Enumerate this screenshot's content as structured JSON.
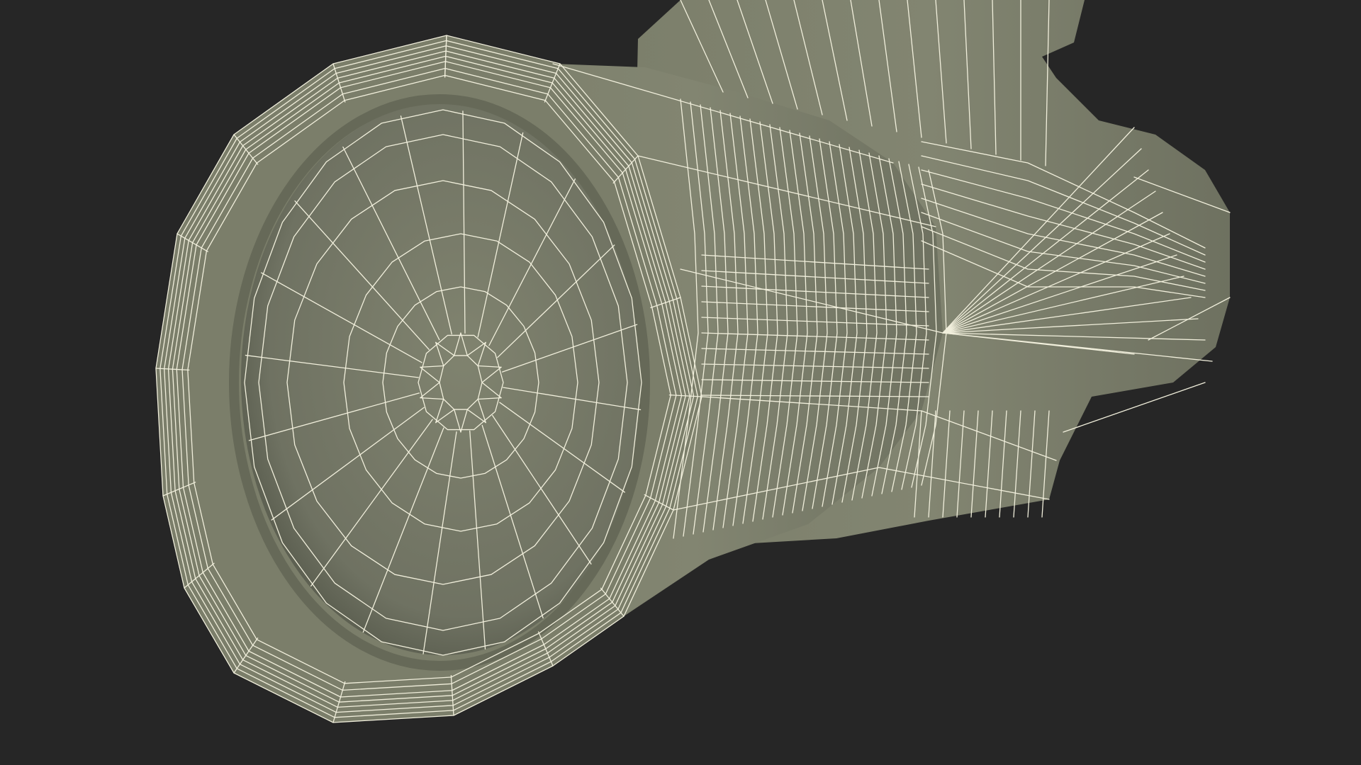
{
  "scene": {
    "background_color": "#262626",
    "mesh_fill_color": "#7a7d6a",
    "mesh_shadow_color": "#5f6253",
    "mesh_highlight_color": "#8b8e78",
    "wire_color": "#f1efdc",
    "subject": "wireframe-mesh-render"
  }
}
